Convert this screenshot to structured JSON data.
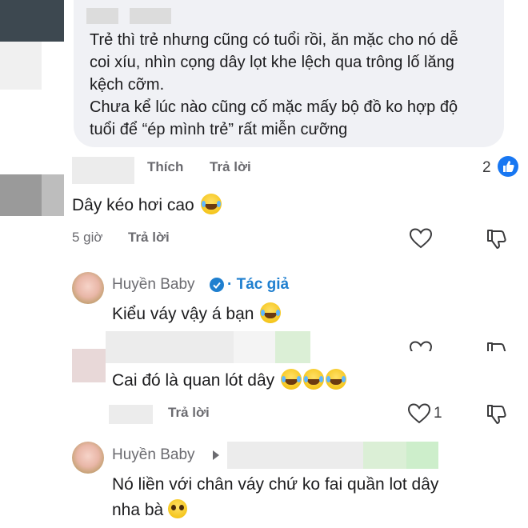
{
  "comment1": {
    "text_lines": [
      "Trẻ thì trẻ nhưng cũng có tuổi rồi, ăn mặc cho nó dễ",
      "coi xíu, nhìn cọng dây lọt khe lệch qua trông lố lăng",
      "kệch cỡm.",
      "Chưa kể lúc nào cũng cố mặc mấy bộ đồ ko hợp độ",
      "tuổi để “ép mình trẻ” rất miễn cưỡng"
    ],
    "like_label": "Thích",
    "reply_label": "Trả lời",
    "reaction_count": "2"
  },
  "comment2": {
    "text": "Dây kéo hơi cao",
    "time": "5 giờ",
    "reply_label": "Trả lời"
  },
  "reply1": {
    "author": "Huyền Baby",
    "author_badge": "· Tác giả",
    "text": "Kiểu váy vậy á bạn"
  },
  "reply2": {
    "text": "Cai đó là quan lót dây",
    "reply_label": "Trả lời",
    "like_count": "1"
  },
  "reply3": {
    "author": "Huyền Baby",
    "text_lines": [
      "Nó liền với chân váy chứ ko fai quần lot dây",
      "nha bà"
    ]
  },
  "colors": {
    "accent": "#1877f2",
    "bubble": "#f0f1f5",
    "author_blue": "#1f7fcf"
  },
  "icons": [
    "heart-outline-icon",
    "thumbs-down-outline-icon",
    "verified-check-icon",
    "play-triangle-icon",
    "laughing-tears-emoji",
    "pleading-face-emoji",
    "like-thumb-icon"
  ]
}
